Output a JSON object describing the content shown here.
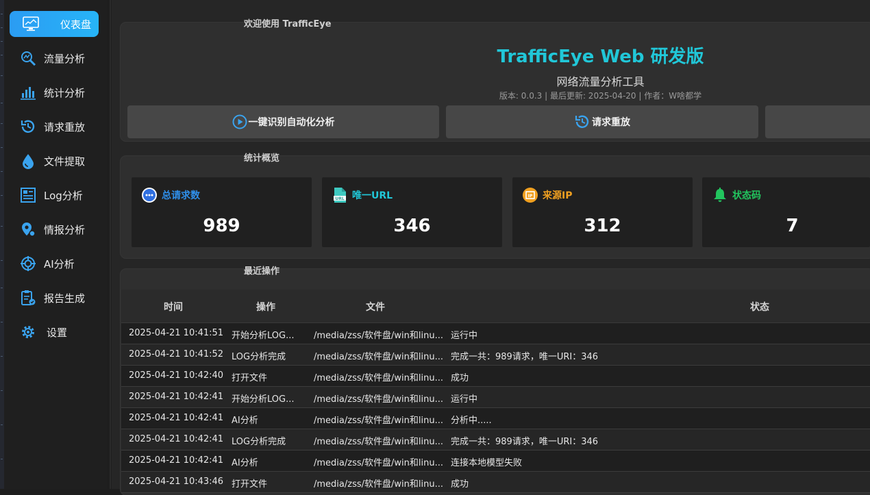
{
  "sidebar": {
    "items": [
      {
        "label": "仪表盘",
        "icon": "monitor-icon",
        "active": true
      },
      {
        "label": "流量分析",
        "icon": "search-analysis-icon"
      },
      {
        "label": "统计分析",
        "icon": "bar-chart-icon"
      },
      {
        "label": "请求重放",
        "icon": "history-icon"
      },
      {
        "label": "文件提取",
        "icon": "drop-icon"
      },
      {
        "label": "Log分析",
        "icon": "log-icon"
      },
      {
        "label": "情报分析",
        "icon": "location-pin-icon"
      },
      {
        "label": "AI分析",
        "icon": "target-icon"
      },
      {
        "label": "报告生成",
        "icon": "report-icon"
      },
      {
        "label": "设置",
        "icon": "gear-icon"
      }
    ]
  },
  "welcome": {
    "title": "欢迎使用 TrafficEye",
    "app_name": "TrafficEye Web 研发版",
    "subtitle": "网络流量分析工具",
    "meta": "版本: 0.0.3 | 最后更新: 2025-04-20 | 作者：W啥都学",
    "buttons": [
      {
        "label": "一键识别自动化分析",
        "icon": "play-circle-icon"
      },
      {
        "label": "请求重放",
        "icon": "history-icon"
      }
    ]
  },
  "stats": {
    "title": "统计概览",
    "cards": [
      {
        "label": "总请求数",
        "value": "989",
        "icon": "chat-bubble-icon",
        "color": "#2f8fea"
      },
      {
        "label": "唯一URL",
        "value": "346",
        "icon": "url-file-icon",
        "color": "#21c7d8"
      },
      {
        "label": "来源IP",
        "value": "312",
        "icon": "ip-icon",
        "color": "#f0a020"
      },
      {
        "label": "状态码",
        "value": "7",
        "icon": "bell-icon",
        "color": "#22c55e"
      }
    ]
  },
  "recent": {
    "title": "最近操作",
    "columns": [
      "时间",
      "操作",
      "文件",
      "状态"
    ],
    "rows": [
      {
        "time": "2025-04-21 10:41:51",
        "action": "开始分析LOG...",
        "file": "/media/zss/软件盘/win和linu...",
        "status": "运行中"
      },
      {
        "time": "2025-04-21 10:41:52",
        "action": "LOG分析完成",
        "file": "/media/zss/软件盘/win和linu...",
        "status": "完成一共：989请求，唯一URI：346"
      },
      {
        "time": "2025-04-21 10:42:40",
        "action": "打开文件",
        "file": "/media/zss/软件盘/win和linu...",
        "status": "成功"
      },
      {
        "time": "2025-04-21 10:42:41",
        "action": "开始分析LOG...",
        "file": "/media/zss/软件盘/win和linu...",
        "status": "运行中"
      },
      {
        "time": "2025-04-21 10:42:41",
        "action": "AI分析",
        "file": "/media/zss/软件盘/win和linu...",
        "status": "分析中....."
      },
      {
        "time": "2025-04-21 10:42:41",
        "action": "LOG分析完成",
        "file": "/media/zss/软件盘/win和linu...",
        "status": "完成一共：989请求，唯一URI：346"
      },
      {
        "time": "2025-04-21 10:42:41",
        "action": "AI分析",
        "file": "/media/zss/软件盘/win和linu...",
        "status": "连接本地模型失败"
      },
      {
        "time": "2025-04-21 10:43:46",
        "action": "打开文件",
        "file": "/media/zss/软件盘/win和linu...",
        "status": "成功"
      }
    ]
  },
  "colors": {
    "accent": "#2b9cf3",
    "title_cyan": "#21c7d8"
  }
}
